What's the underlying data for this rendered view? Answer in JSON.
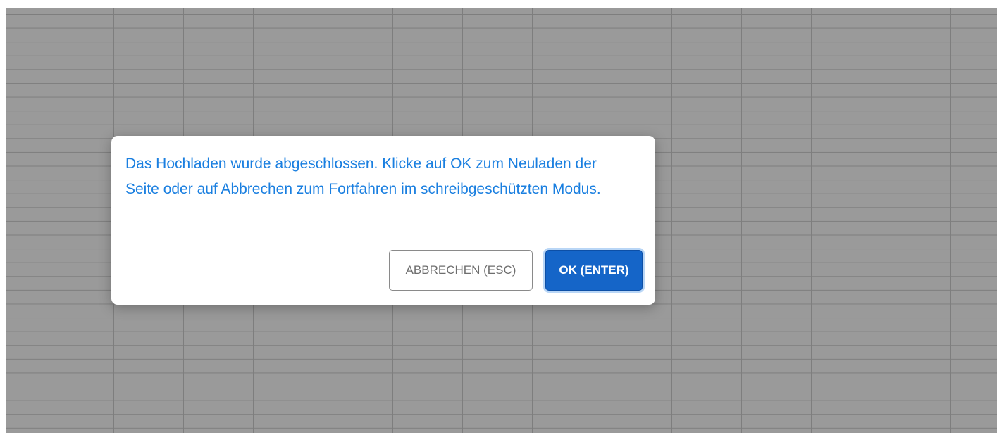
{
  "dialog": {
    "message": "Das Hochladen wurde abgeschlossen. Klicke auf OK zum Neuladen der Seite oder auf Abbrechen zum Fortfahren im schreibgeschützten Modus.",
    "cancel_label": "ABBRECHEN (ESC)",
    "ok_label": "OK (ENTER)"
  },
  "colors": {
    "message_text": "#1a7fe0",
    "ok_button": "#1565c8",
    "backdrop_grid": "#9a9a9a"
  }
}
